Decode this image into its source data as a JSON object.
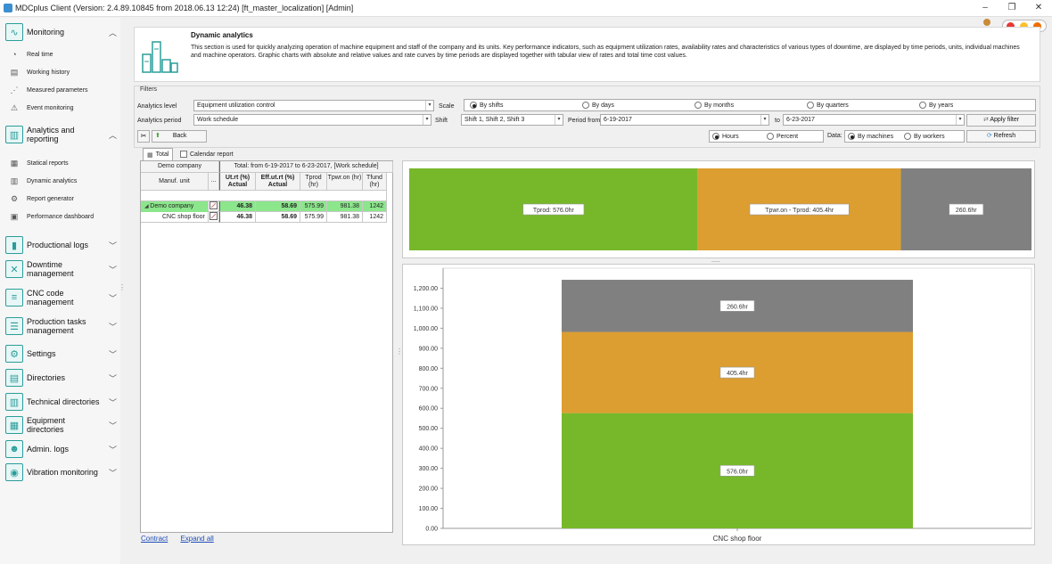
{
  "window": {
    "title": "MDCplus Client (Version: 2.4.89.10845 from 2018.06.13 12:24) [ft_master_localization]  [Admin]",
    "min": "–",
    "restore": "❐",
    "close": "✕"
  },
  "colors": {
    "green": "#77b82a",
    "orange": "#dc9e30",
    "gray": "#808080",
    "teal": "#2a9d9a"
  },
  "sidebar": {
    "sections": [
      {
        "label": "Monitoring",
        "icon": "monitoring-icon",
        "expanded": true,
        "items": [
          "Real time",
          "Working history",
          "Measured parameters",
          "Event monitoring"
        ]
      },
      {
        "label": "Analytics and reporting",
        "icon": "analytics-icon",
        "expanded": true,
        "items": [
          "Statical reports",
          "Dynamic analytics",
          "Report generator",
          "Performance dashboard"
        ]
      },
      {
        "label": "Productional logs",
        "icon": "logs-icon"
      },
      {
        "label": "Downtime management",
        "icon": "downtime-icon"
      },
      {
        "label": "CNC code management",
        "icon": "cnc-code-icon"
      },
      {
        "label": "Production tasks management",
        "icon": "tasks-icon"
      },
      {
        "label": "Settings",
        "icon": "gear-icon"
      },
      {
        "label": "Directories",
        "icon": "directories-icon"
      },
      {
        "label": "Technical directories",
        "icon": "tech-directories-icon"
      },
      {
        "label": "Equipment directories",
        "icon": "equipment-icon"
      },
      {
        "label": "Admin. logs",
        "icon": "admin-logs-icon"
      },
      {
        "label": "Vibration monitoring",
        "icon": "vibration-icon"
      }
    ]
  },
  "header": {
    "title": "Dynamic analytics",
    "description": "This section is used for quickly analyzing operation of machine equipment and staff of the company and its units. Key performance indicators, such as equipment utilization rates, availability rates and characteristics of various types of downtime, are displayed by time periods, units, individual machines and machine operators. Graphic charts with absolute and relative values and rate curves by time periods are displayed together with tabular view of rates and total time cost values."
  },
  "filters": {
    "legend": "Filters",
    "analytics_level_label": "Analytics level",
    "analytics_level": "Equipment utilization control",
    "scale_label": "Scale",
    "scale_options": [
      "By shifts",
      "By days",
      "By months",
      "By quarters",
      "By years"
    ],
    "analytics_period_label": "Analytics period",
    "analytics_period": "Work schedule",
    "shift_label": "Shift",
    "shift": "Shift 1, Shift 2, Shift 3",
    "period_from_label": "Period from",
    "period_from": "6-19-2017",
    "to_label": "to",
    "period_to": "6-23-2017",
    "apply": "Apply filter",
    "back": "Back",
    "hours": "Hours",
    "percent": "Percent",
    "data_label": "Data:",
    "by_machines": "By machines",
    "by_workers": "By workers",
    "refresh": "Refresh"
  },
  "tabs": {
    "total": "Total",
    "calendar": "Calendar report"
  },
  "grid": {
    "company_header": "Demo company",
    "total_header": "Total: from 6-19-2017 to 6-23-2017, [Work schedule]",
    "col_unit": "Manuf. unit",
    "col_dots": "...",
    "columns": [
      "Ut.rt (%) Actual",
      "Eff.ut.rt (%) Actual",
      "Tprod (hr)",
      "Tpwr.on (hr)",
      "Tfund (hr)"
    ],
    "rows": [
      {
        "name": "Demo company",
        "values": [
          "46.38",
          "58.69",
          "575.99",
          "981.38",
          "1242"
        ]
      },
      {
        "name": "CNC shop floor",
        "values": [
          "46.38",
          "58.69",
          "575.99",
          "981.38",
          "1242"
        ]
      }
    ],
    "contract": "Contract",
    "expand_all": "Expand all"
  },
  "chart_data": [
    {
      "type": "bar",
      "orientation": "horizontal-stacked",
      "segments": [
        {
          "label": "Tprod: 576.0hr",
          "value": 576.0,
          "color": "#77b82a"
        },
        {
          "label": "Tpwr.on - Tprod: 405.4hr",
          "value": 405.4,
          "color": "#dc9e30"
        },
        {
          "label": "260.6hr",
          "value": 260.6,
          "color": "#808080"
        }
      ]
    },
    {
      "type": "bar",
      "orientation": "vertical-stacked",
      "categories": [
        "CNC shop floor"
      ],
      "ylim": [
        0,
        1300
      ],
      "yticks": [
        "0.00",
        "100.00",
        "200.00",
        "300.00",
        "400.00",
        "500.00",
        "600.00",
        "700.00",
        "800.00",
        "900.00",
        "1,000.00",
        "1,100.00",
        "1,200.00"
      ],
      "series": [
        {
          "values": [
            576.0
          ],
          "label": "576.0hr",
          "color": "#77b82a"
        },
        {
          "values": [
            405.4
          ],
          "label": "405.4hr",
          "color": "#dc9e30"
        },
        {
          "values": [
            260.6
          ],
          "label": "260.6hr",
          "color": "#808080"
        }
      ]
    }
  ]
}
